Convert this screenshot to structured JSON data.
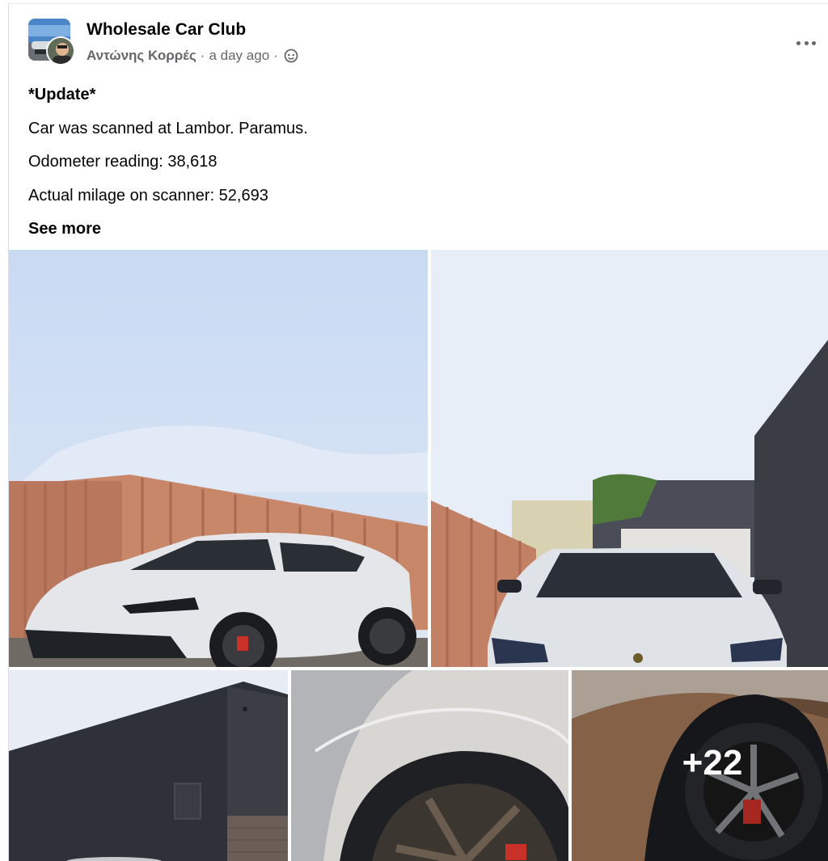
{
  "post": {
    "group_name": "Wholesale Car Club",
    "author": "Αντώνης Κορρές",
    "timestamp": "a day ago",
    "separator": "·",
    "audience_icon": "globe-icon",
    "menu_icon": "more-options-icon",
    "body": {
      "title": "*Update*",
      "lines": [
        "Car was scanned at Lambor. Paramus.",
        "Odometer reading: 38,618",
        "Actual milage on scanner: 52,693"
      ],
      "see_more": "See more"
    },
    "photos": {
      "more_count": "+22"
    }
  }
}
